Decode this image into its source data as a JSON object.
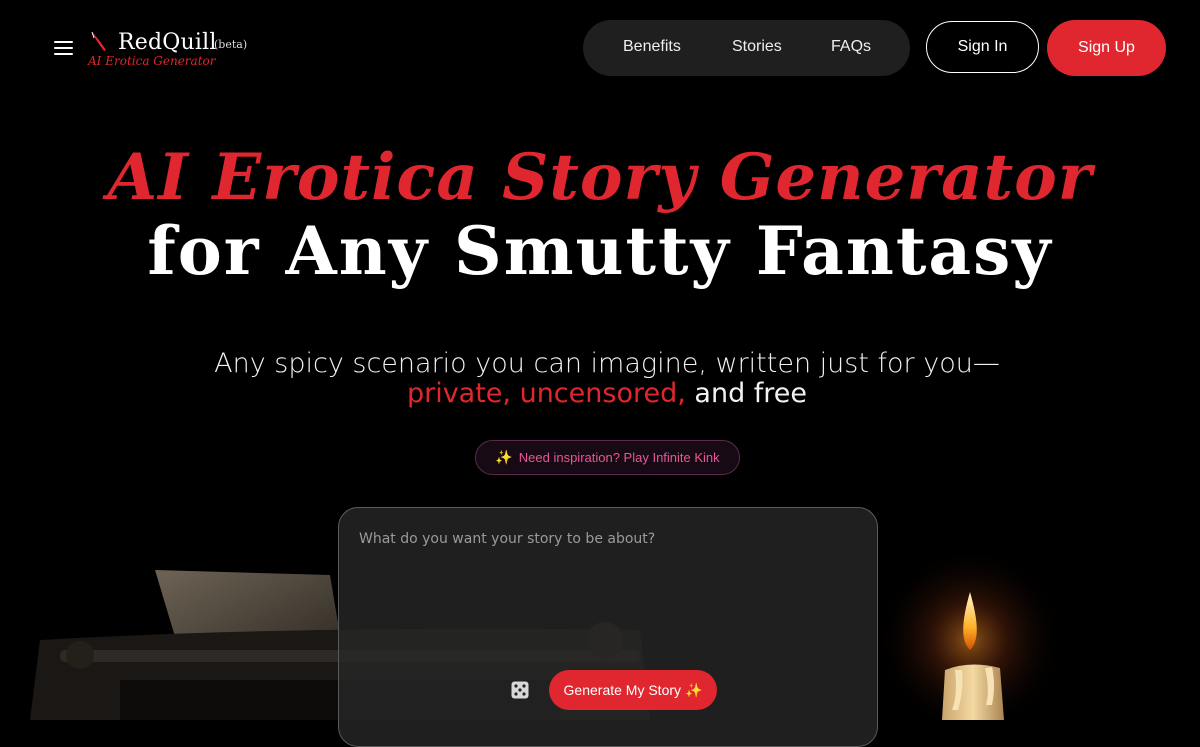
{
  "header": {
    "menu_icon": "hamburger-menu-icon",
    "brand": {
      "name": "RedQuill",
      "beta": "(beta)",
      "tagline": "AI Erotica Generator",
      "logo_icon": "quill-icon"
    },
    "nav": [
      {
        "label": "Benefits"
      },
      {
        "label": "Stories"
      },
      {
        "label": "FAQs"
      }
    ],
    "sign_in": "Sign In",
    "sign_up": "Sign Up"
  },
  "hero": {
    "title_line1": "AI Erotica Story Generator",
    "title_line2": "for Any Smutty Fantasy",
    "subtitle_line1": "Any spicy scenario you can imagine, written just for you—",
    "subtitle_red": "private, uncensored,",
    "subtitle_white": "and free",
    "inspiration": {
      "icon": "✨",
      "label": "Need inspiration? Play Infinite Kink"
    }
  },
  "prompt": {
    "placeholder": "What do you want your story to be about?",
    "value": "",
    "dice_icon": "dice-icon",
    "generate_label": "Generate My Story",
    "generate_icon": "✨"
  },
  "colors": {
    "accent": "#e0262e",
    "background": "#000000",
    "pill": "#1f1f1f",
    "inspire_text": "#e8559a"
  }
}
